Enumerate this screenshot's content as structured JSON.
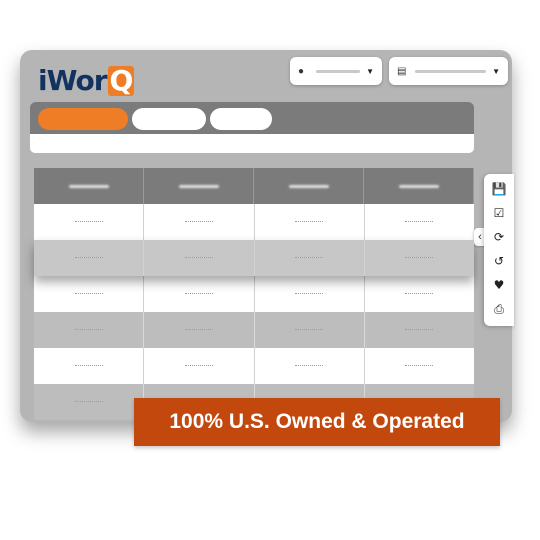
{
  "app": {
    "logo_text": "iWor",
    "logo_q": "Q",
    "brand_color": "#ef7d25",
    "logo_color": "#12335f"
  },
  "header": {
    "user_dropdown": {
      "icon": "user-icon",
      "value": ""
    },
    "menu_dropdown": {
      "icon": "list-icon",
      "value": ""
    }
  },
  "tabs": [
    {
      "label": "",
      "active": true
    },
    {
      "label": "",
      "active": false
    },
    {
      "label": "",
      "active": false
    }
  ],
  "table": {
    "columns": [
      "",
      "",
      "",
      ""
    ],
    "rows": 6
  },
  "side_toolbar": {
    "icons": [
      "save-icon",
      "checklist-icon",
      "refresh-icon",
      "history-icon",
      "favorite-icon",
      "print-icon"
    ]
  },
  "banner": {
    "text": "100% U.S. Owned & Operated",
    "color": "#c2480e"
  }
}
